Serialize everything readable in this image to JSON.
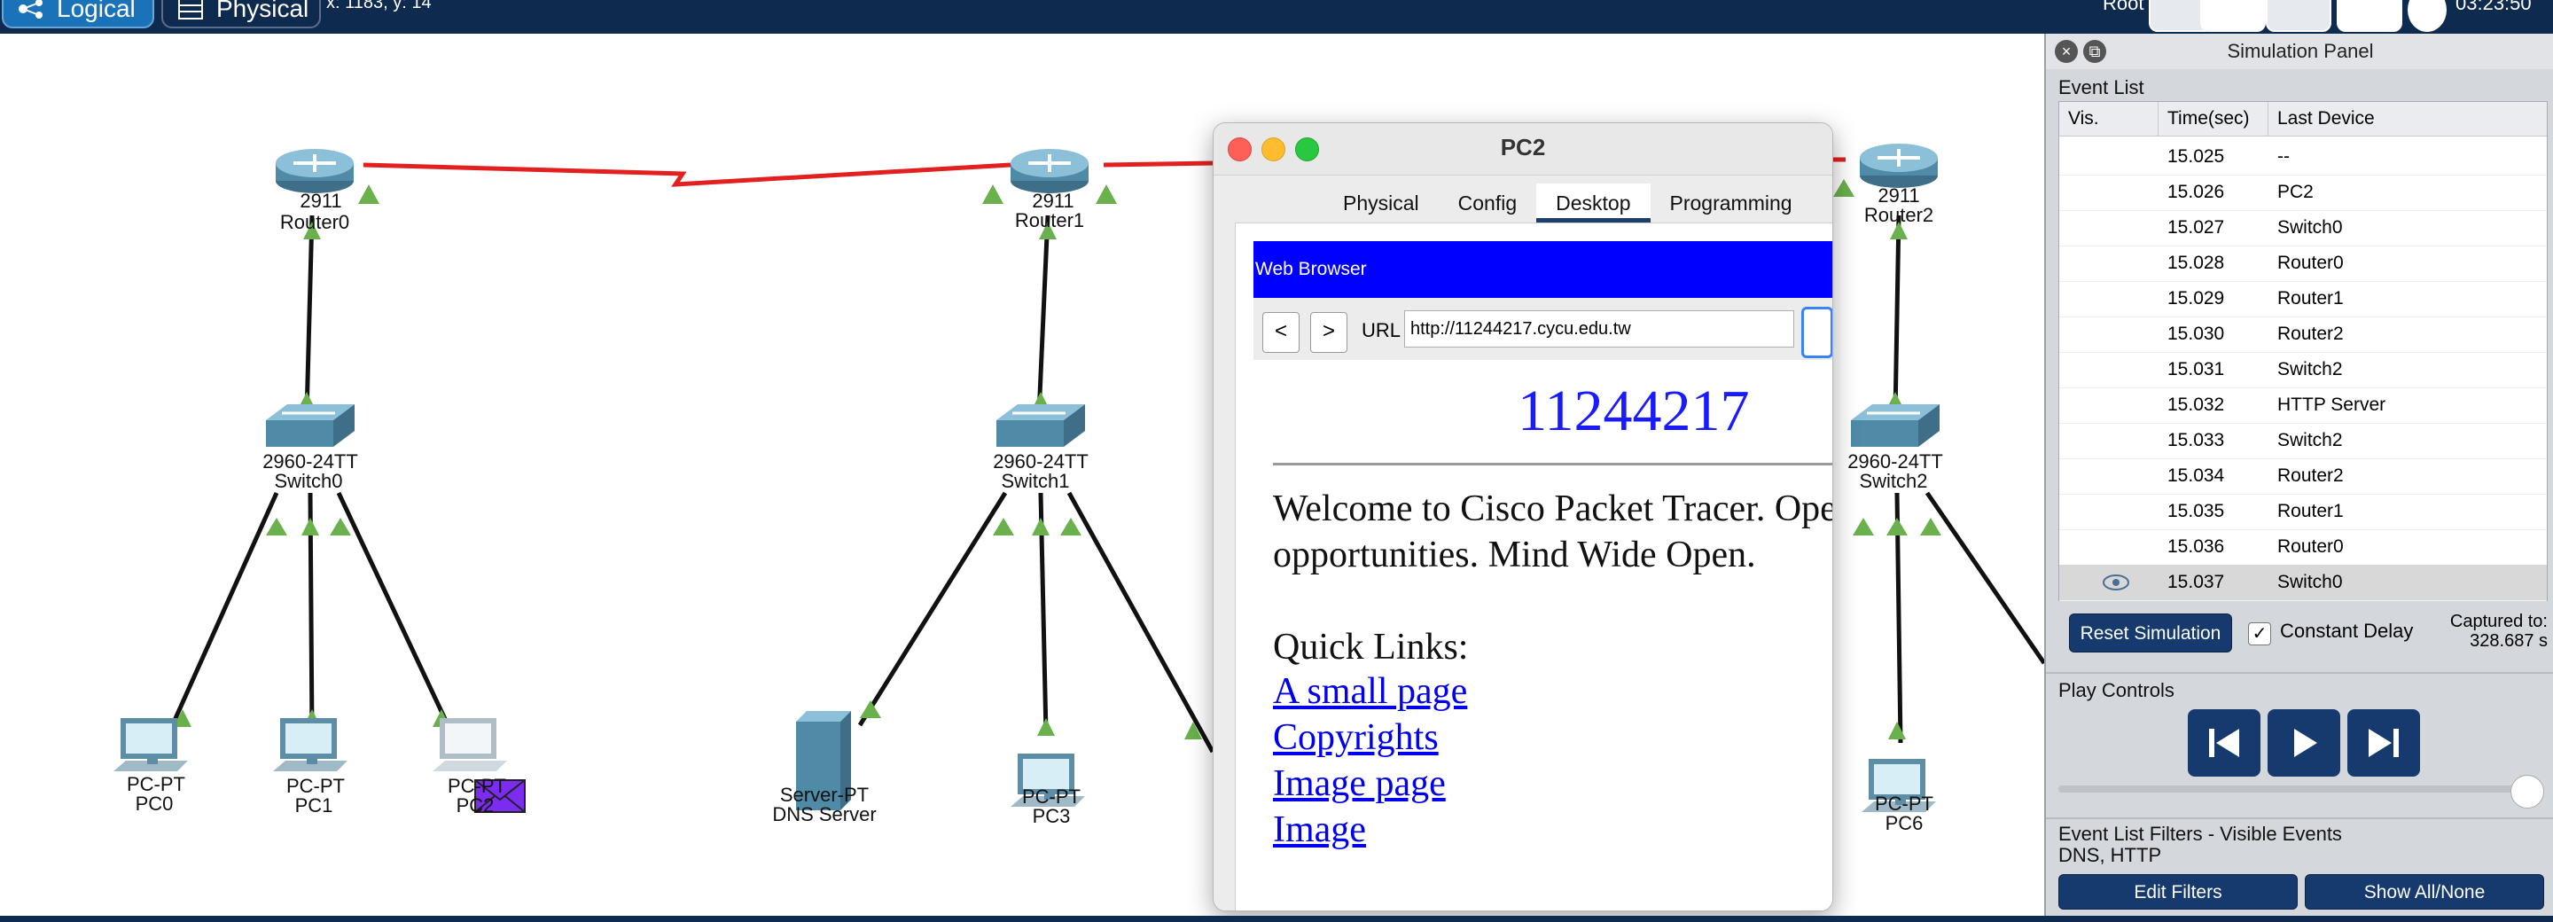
{
  "topbar": {
    "logical_label": "Logical",
    "physical_label": "Physical",
    "coords": "x: 1183, y: 14",
    "root_label": "Root",
    "clock": "03:23:50"
  },
  "topology": {
    "routers": [
      {
        "model": "2911",
        "name": "Router0"
      },
      {
        "model": "2911",
        "name": "Router1"
      },
      {
        "model": "2911",
        "name": "Router2"
      }
    ],
    "switches": [
      {
        "model": "2960-24TT",
        "name": "Switch0"
      },
      {
        "model": "2960-24TT",
        "name": "Switch1"
      },
      {
        "model": "2960-24TT",
        "name": "Switch2"
      }
    ],
    "hosts": [
      {
        "model": "PC-PT",
        "name": "PC0"
      },
      {
        "model": "PC-PT",
        "name": "PC1"
      },
      {
        "model": "PC-PT",
        "name": "PC2"
      },
      {
        "model": "Server-PT",
        "name": "DNS Server"
      },
      {
        "model": "PC-PT",
        "name": "PC3"
      },
      {
        "model": "PC-PT",
        "name": "PC6"
      }
    ],
    "colors": {
      "serial_link": "#e32020",
      "link": "#111111",
      "port_up": "#6ab04c",
      "packet": "#7b2cf0"
    }
  },
  "pc2_window": {
    "title": "PC2",
    "tabs": [
      "Physical",
      "Config",
      "Desktop",
      "Programming"
    ],
    "active_tab": "Desktop",
    "browser_title": "Web Browser",
    "back": "<",
    "forward": ">",
    "url_label": "URL",
    "url": "http://11244217.cycu.edu.tw",
    "page": {
      "heading": "11244217",
      "text": "Welcome to Cisco Packet Tracer. Opening doors to new opportunities. Mind Wide Open.",
      "quick_links_title": "Quick Links:",
      "links": [
        "A small page",
        "Copyrights",
        "Image page",
        "Image"
      ]
    }
  },
  "sim_panel": {
    "title": "Simulation Panel",
    "event_list_label": "Event List",
    "columns": [
      "Vis.",
      "Time(sec)",
      "Last Device"
    ],
    "events": [
      {
        "time": "15.025",
        "device": "--"
      },
      {
        "time": "15.026",
        "device": "PC2"
      },
      {
        "time": "15.027",
        "device": "Switch0"
      },
      {
        "time": "15.028",
        "device": "Router0"
      },
      {
        "time": "15.029",
        "device": "Router1"
      },
      {
        "time": "15.030",
        "device": "Router2"
      },
      {
        "time": "15.031",
        "device": "Switch2"
      },
      {
        "time": "15.032",
        "device": "HTTP Server"
      },
      {
        "time": "15.033",
        "device": "Switch2"
      },
      {
        "time": "15.034",
        "device": "Router2"
      },
      {
        "time": "15.035",
        "device": "Router1"
      },
      {
        "time": "15.036",
        "device": "Router0"
      },
      {
        "time": "15.037",
        "device": "Switch0"
      }
    ],
    "reset_label": "Reset Simulation",
    "constant_delay_label": "Constant Delay",
    "constant_delay_checked": "✓",
    "captured_label": "Captured to:",
    "captured_value": "328.687 s",
    "play_controls_label": "Play Controls",
    "filters_label": "Event List Filters - Visible Events",
    "filters_value": "DNS, HTTP",
    "edit_filters_label": "Edit Filters",
    "show_all_label": "Show All/None",
    "accent_color": "#163a6e"
  }
}
